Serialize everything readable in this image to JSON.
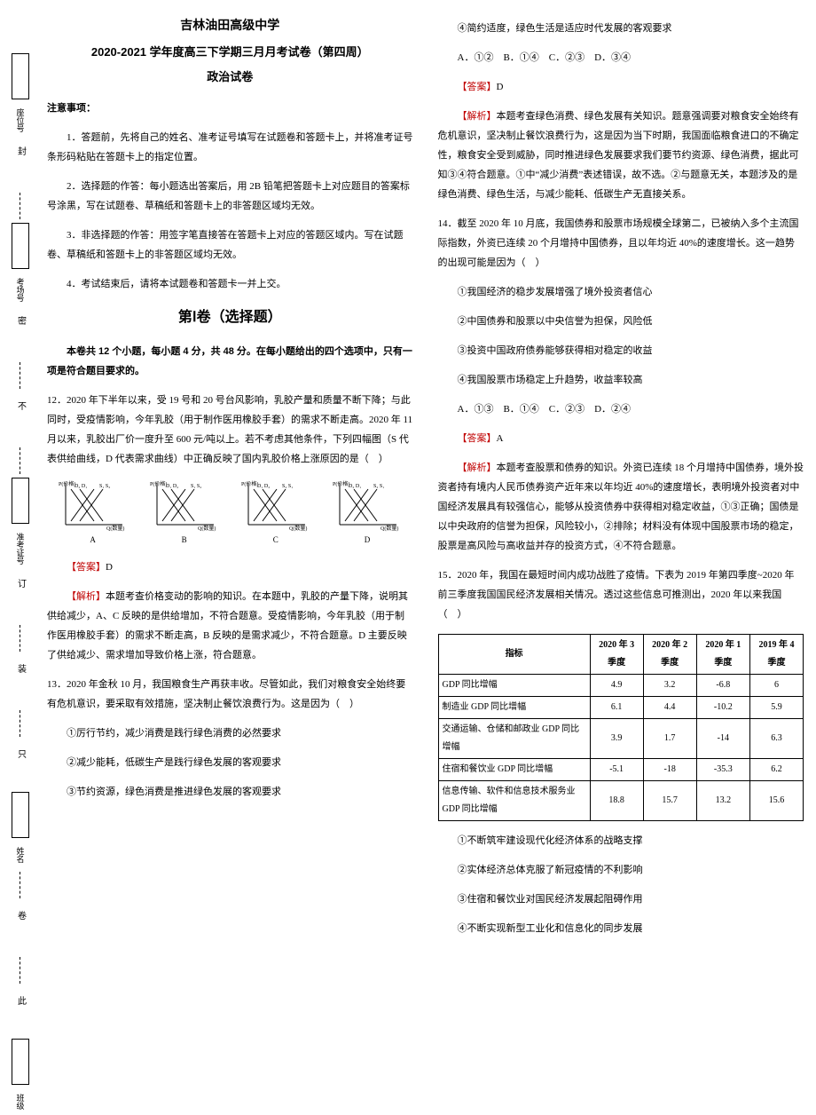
{
  "binding": {
    "chars": "封密不订装只此",
    "labels": [
      "座位号",
      "考场号",
      "准考证号",
      "姓名",
      "班级"
    ]
  },
  "header": {
    "school": "吉林油田高级中学",
    "title": "2020-2021 学年度高三下学期三月月考试卷（第四周）",
    "subject": "政治试卷"
  },
  "notice_h": "注意事项：",
  "notice": [
    "1．答题前，先将自己的姓名、准考证号填写在试题卷和答题卡上，并将准考证号条形码粘贴在答题卡上的指定位置。",
    "2．选择题的作答：每小题选出答案后，用 2B 铅笔把答题卡上对应题目的答案标号涂黑，写在试题卷、草稿纸和答题卡上的非答题区域均无效。",
    "3．非选择题的作答：用签字笔直接答在答题卡上对应的答题区域内。写在试题卷、草稿纸和答题卡上的非答题区域均无效。",
    "4．考试结束后，请将本试题卷和答题卡一并上交。"
  ],
  "part1_h": "第Ⅰ卷（选择题）",
  "part1_desc": "本卷共 12 个小题，每小题 4 分，共 48 分。在每小题给出的四个选项中，只有一项是符合题目要求的。",
  "q12": {
    "stem": "12．2020 年下半年以来，受 19 号和 20 号台风影响，乳胶产量和质量不断下降；与此同时，受疫情影响，今年乳胶（用于制作医用橡胶手套）的需求不断走高。2020 年 11 月以来，乳胶出厂价一度升至 600 元/吨以上。若不考虑其他条件，下列四幅图（S 代表供给曲线，D 代表需求曲线）中正确反映了国内乳胶价格上涨原因的是（　）",
    "labels": [
      "A",
      "B",
      "C",
      "D"
    ],
    "axis_y": "P(价格)",
    "axis_x": "Q(数量)",
    "ans_lbl": "【答案】",
    "ans": "D",
    "exp_lbl": "【解析】",
    "exp": "本题考查价格变动的影响的知识。在本题中，乳胶的产量下降，说明其供给减少，A、C 反映的是供给增加，不符合题意。受疫情影响，今年乳胶（用于制作医用橡胶手套）的需求不断走高，B 反映的是需求减少，不符合题意。D 主要反映了供给减少、需求增加导致价格上涨，符合题意。"
  },
  "q13": {
    "stem": "13．2020 年金秋 10 月，我国粮食生产再获丰收。尽管如此，我们对粮食安全始终要有危机意识，要采取有效措施，坚决制止餐饮浪费行为。这是因为（　）",
    "opts": [
      "①厉行节约，减少消费是践行绿色消费的必然要求",
      "②减少能耗，低碳生产是践行绿色发展的客观要求",
      "③节约资源，绿色消费是推进绿色发展的客观要求",
      "④简约适度，绿色生活是适应时代发展的客观要求"
    ],
    "choice": "A．①②　B．①④　C．②③　D．③④",
    "ans_lbl": "【答案】",
    "ans": "D",
    "exp_lbl": "【解析】",
    "exp": "本题考查绿色消费、绿色发展有关知识。题意强调要对粮食安全始终有危机意识，坚决制止餐饮浪费行为，这是因为当下时期，我国面临粮食进口的不确定性，粮食安全受到威胁，同时推进绿色发展要求我们要节约资源、绿色消费，据此可知③④符合题意。①中“减少消费”表述错误，故不选。②与题意无关，本题涉及的是绿色消费、绿色生活，与减少能耗、低碳生产无直接关系。"
  },
  "q14": {
    "stem": "14．截至 2020 年 10 月底，我国债券和股票市场规模全球第二，已被纳入多个主流国际指数，外资已连续 20 个月增持中国债券，且以年均近 40%的速度增长。这一趋势的出现可能是因为（　）",
    "opts": [
      "①我国经济的稳步发展增强了境外投资者信心",
      "②中国债券和股票以中央信誉为担保，风险低",
      "③投资中国政府债券能够获得相对稳定的收益",
      "④我国股票市场稳定上升趋势，收益率较高"
    ],
    "choice": "A．①③　B．①④　C．②③　D．②④",
    "ans_lbl": "【答案】",
    "ans": "A",
    "exp_lbl": "【解析】",
    "exp": "本题考查股票和债券的知识。外资已连续 18 个月增持中国债券，境外投资者持有境内人民币债券资产近年来以年均近 40%的速度增长，表明境外投资者对中国经济发展具有较强信心，能够从投资债券中获得相对稳定收益，①③正确；国债是以中央政府的信誉为担保，风险较小，②排除；材料没有体现中国股票市场的稳定，股票是高风险与高收益并存的投资方式，④不符合题意。"
  },
  "q15": {
    "stem": "15．2020 年，我国在最短时间内成功战胜了疫情。下表为 2019 年第四季度~2020 年前三季度我国国民经济发展相关情况。透过这些信息可推测出，2020 年以来我国（　）",
    "opts": [
      "①不断筑牢建设现代化经济体系的战略支撑",
      "②实体经济总体克服了新冠疫情的不利影响",
      "③住宿和餐饮业对国民经济发展起阻碍作用",
      "④不断实现新型工业化和信息化的同步发展"
    ]
  },
  "chart_data": {
    "type": "table",
    "title": "",
    "columns": [
      "指标",
      "2020 年 3 季度",
      "2020 年 2 季度",
      "2020 年 1 季度",
      "2019 年 4 季度"
    ],
    "rows": [
      [
        "GDP 同比增幅",
        "4.9",
        "3.2",
        "-6.8",
        "6"
      ],
      [
        "制造业 GDP 同比增幅",
        "6.1",
        "4.4",
        "-10.2",
        "5.9"
      ],
      [
        "交通运输、仓储和邮政业 GDP 同比增幅",
        "3.9",
        "1.7",
        "-14",
        "6.3"
      ],
      [
        "住宿和餐饮业 GDP 同比增幅",
        "-5.1",
        "-18",
        "-35.3",
        "6.2"
      ],
      [
        "信息传输、软件和信息技术服务业 GDP 同比增幅",
        "18.8",
        "15.7",
        "13.2",
        "15.6"
      ]
    ]
  }
}
